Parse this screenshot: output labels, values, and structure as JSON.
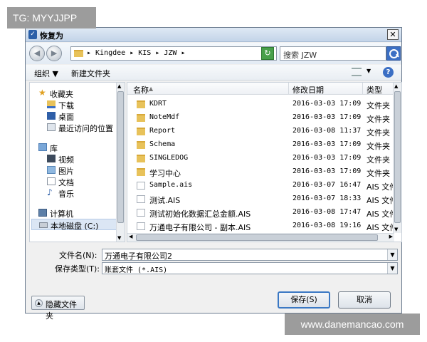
{
  "tag_text": "TG: MYYJJPP",
  "watermark_text": "www.danemancao.com",
  "dialog": {
    "title": "恢复为",
    "close_glyph": "✕"
  },
  "address": {
    "crumbs": "▸ Kingdee ▸ KIS ▸ JZW ▸",
    "search_placeholder": "搜索 JZW"
  },
  "toolbar": {
    "organize": "组织 ▼",
    "new_folder": "新建文件夹"
  },
  "nav": {
    "items": [
      {
        "label": "收藏夹",
        "icon": "star-icon"
      },
      {
        "label": "下载",
        "icon": "download-folder-icon"
      },
      {
        "label": "桌面",
        "icon": "desktop-icon"
      },
      {
        "label": "最近访问的位置",
        "icon": "recent-places-icon"
      },
      {
        "label": "库",
        "icon": "library-icon"
      },
      {
        "label": "视频",
        "icon": "video-icon"
      },
      {
        "label": "图片",
        "icon": "picture-icon"
      },
      {
        "label": "文档",
        "icon": "document-icon"
      },
      {
        "label": "音乐",
        "icon": "music-icon"
      },
      {
        "label": "计算机",
        "icon": "computer-icon"
      },
      {
        "label": "本地磁盘 (C:)",
        "icon": "drive-icon"
      }
    ]
  },
  "columns": {
    "name": "名称",
    "modified": "修改日期",
    "type": "类型"
  },
  "files": [
    {
      "name": "KDRT",
      "date": "2016-03-03 17:09",
      "type": "文件夹",
      "kind": "folder"
    },
    {
      "name": "NoteMdf",
      "date": "2016-03-03 17:09",
      "type": "文件夹",
      "kind": "folder"
    },
    {
      "name": "Report",
      "date": "2016-03-08 11:37",
      "type": "文件夹",
      "kind": "folder"
    },
    {
      "name": "Schema",
      "date": "2016-03-03 17:09",
      "type": "文件夹",
      "kind": "folder"
    },
    {
      "name": "SINGLEDOG",
      "date": "2016-03-03 17:09",
      "type": "文件夹",
      "kind": "folder"
    },
    {
      "name": "学习中心",
      "date": "2016-03-03 17:09",
      "type": "文件夹",
      "kind": "folder"
    },
    {
      "name": "Sample.ais",
      "date": "2016-03-07 16:47",
      "type": "AIS 文件",
      "kind": "file"
    },
    {
      "name": "测试.AIS",
      "date": "2016-03-07 18:33",
      "type": "AIS 文件",
      "kind": "file"
    },
    {
      "name": "测试初始化数据汇总金额.AIS",
      "date": "2016-03-08 17:47",
      "type": "AIS 文件",
      "kind": "file"
    },
    {
      "name": "万通电子有限公司 - 副本.AIS",
      "date": "2016-03-08 19:16",
      "type": "AIS 文件",
      "kind": "file"
    }
  ],
  "form": {
    "filename_label": "文件名(N):",
    "filename_value": "万通电子有限公司2",
    "filetype_label": "保存类型(T):",
    "filetype_value": "账套文件 (*.AIS)"
  },
  "buttons": {
    "hide_folders": "隐藏文件夹",
    "save": "保存(S)",
    "cancel": "取消"
  }
}
